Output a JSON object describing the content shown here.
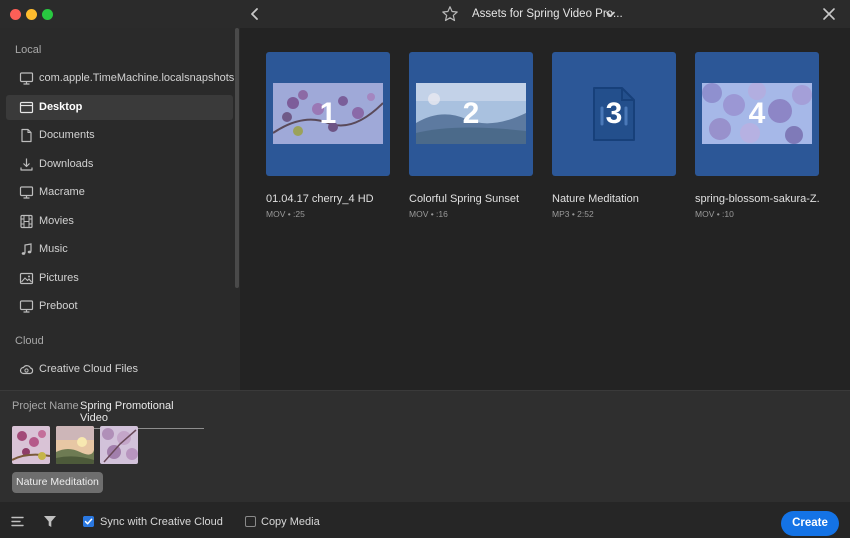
{
  "window": {
    "title": "Assets for Spring Video Pro...",
    "icons": {
      "back": "chevron-left-icon",
      "favorite": "star-icon",
      "dropdown": "chevron-down-icon",
      "close": "close-icon"
    }
  },
  "sidebar": {
    "local_heading": "Local",
    "cloud_heading": "Cloud",
    "local_items": [
      {
        "label": "com.apple.TimeMachine.localsnapshots",
        "icon": "monitor-icon"
      },
      {
        "label": "Desktop",
        "icon": "desktop-icon",
        "selected": true
      },
      {
        "label": "Documents",
        "icon": "document-icon"
      },
      {
        "label": "Downloads",
        "icon": "download-icon"
      },
      {
        "label": "Macrame",
        "icon": "monitor-icon"
      },
      {
        "label": "Movies",
        "icon": "film-icon"
      },
      {
        "label": "Music",
        "icon": "music-note-icon"
      },
      {
        "label": "Pictures",
        "icon": "picture-icon"
      },
      {
        "label": "Preboot",
        "icon": "monitor-icon"
      }
    ],
    "cloud_items": [
      {
        "label": "Creative Cloud Files",
        "icon": "creative-cloud-icon"
      }
    ]
  },
  "assets": [
    {
      "number": "1",
      "title": "01.04.17 cherry_4 HD",
      "meta": "MOV • :25",
      "kind": "video"
    },
    {
      "number": "2",
      "title": "Colorful Spring Sunset",
      "meta": "MOV • :16",
      "kind": "video"
    },
    {
      "number": "3",
      "title": "Nature Meditation",
      "meta": "MP3 • 2:52",
      "kind": "audio"
    },
    {
      "number": "4",
      "title": "spring-blossom-sakura-Z...",
      "meta": "MOV • :10",
      "kind": "video"
    }
  ],
  "project": {
    "name_label": "Project Name",
    "name_value": "Spring Promotional Video",
    "selected_audio": "Nature Meditation"
  },
  "bottom": {
    "sync_label": "Sync with Creative Cloud",
    "sync_checked": true,
    "copy_label": "Copy Media",
    "copy_checked": false,
    "create_label": "Create",
    "icons": {
      "list": "list-view-icon",
      "filter": "filter-icon"
    }
  },
  "colors": {
    "accent": "#1473e6",
    "tile": "#2c5797",
    "checkbox": "#2a78e1"
  }
}
